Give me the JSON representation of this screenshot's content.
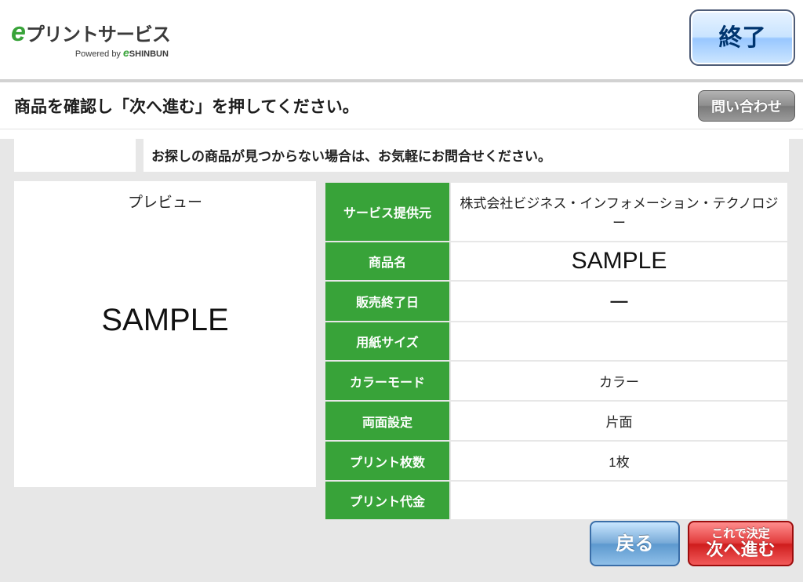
{
  "logo": {
    "service_jp": "プリントサービス",
    "powered_by": "Powered by",
    "shinbun": "SHINBUN"
  },
  "buttons": {
    "exit": "終了",
    "inquiry": "問い合わせ",
    "back": "戻る",
    "confirm_line1": "これで決定",
    "confirm_line2": "次へ進む"
  },
  "instruction": "商品を確認し「次へ進む」を押してください。",
  "helper": "お探しの商品が見つからない場合は、お気軽にお問合せください。",
  "preview": {
    "title": "プレビュー",
    "sample_text": "SAMPLE"
  },
  "details": {
    "rows": [
      {
        "label": "サービス提供元",
        "value": "株式会社ビジネス・インフォメーション・テクノロジー"
      },
      {
        "label": "商品名",
        "value": "SAMPLE"
      },
      {
        "label": "販売終了日",
        "value": "—"
      },
      {
        "label": "用紙サイズ",
        "value": ""
      },
      {
        "label": "カラーモード",
        "value": "カラー"
      },
      {
        "label": "両面設定",
        "value": "片面"
      },
      {
        "label": "プリント枚数",
        "value": "1枚"
      },
      {
        "label": "プリント代金",
        "value": ""
      }
    ]
  }
}
